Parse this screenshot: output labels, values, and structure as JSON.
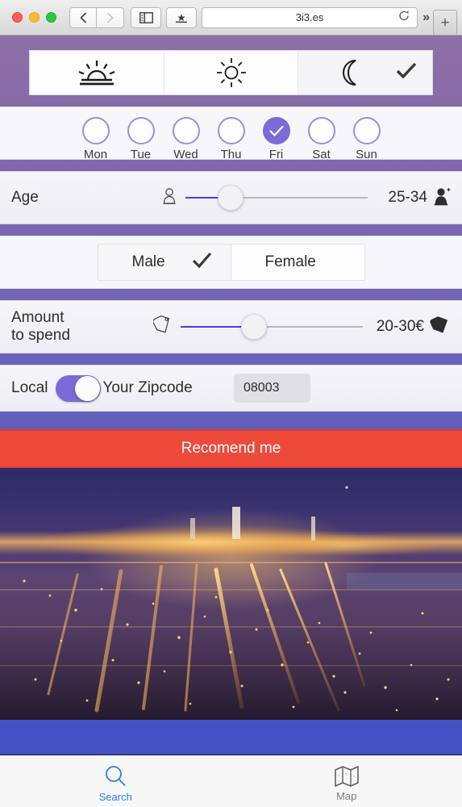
{
  "browser": {
    "url": "3i3.es",
    "back_label": "‹",
    "forward_label": "›",
    "sidebar_icon": "sidebar-icon",
    "bookmark_icon": "bookmarks-icon",
    "reload_icon": "reload-icon",
    "more_label": "»",
    "newtab_label": "+",
    "traffic": {
      "close": "close",
      "minimize": "minimize",
      "zoom": "zoom"
    }
  },
  "timeofday": {
    "items": [
      {
        "icon": "sunrise-icon",
        "name": "sunrise",
        "selected": false
      },
      {
        "icon": "sun-icon",
        "name": "midday",
        "selected": false
      },
      {
        "icon": "moon-icon",
        "name": "night",
        "selected": true
      }
    ],
    "check_glyph": "✔"
  },
  "days": {
    "items": [
      {
        "label": "Mon",
        "selected": false
      },
      {
        "label": "Tue",
        "selected": false
      },
      {
        "label": "Wed",
        "selected": false
      },
      {
        "label": "Thu",
        "selected": false
      },
      {
        "label": "Fri",
        "selected": true
      },
      {
        "label": "Sat",
        "selected": false
      },
      {
        "label": "Sun",
        "selected": false
      }
    ],
    "check_glyph": "✓"
  },
  "age": {
    "label": "Age",
    "value": "25-34",
    "fill_percent": 25,
    "left_icon": "person-small-icon",
    "right_icon": "person-large-icon"
  },
  "gender": {
    "options": [
      {
        "label": "Male",
        "selected": true
      },
      {
        "label": "Female",
        "selected": false
      }
    ],
    "check_glyph": "✔"
  },
  "amount": {
    "label_line1": "Amount",
    "label_line2": "to spend",
    "value": "20-30€",
    "fill_percent": 40,
    "left_icon": "pricetag-outline-icon",
    "right_icon": "pricetag-filled-icon"
  },
  "local": {
    "label": "Local",
    "toggle_on": true,
    "zipcode_label": "Your Zipcode",
    "zipcode_value": "08003"
  },
  "cta": {
    "label": "Recomend me"
  },
  "photo": {
    "alt": "night city skyline"
  },
  "tabbar": {
    "tabs": [
      {
        "label": "Search",
        "icon": "search-icon",
        "active": true
      },
      {
        "label": "Map",
        "icon": "map-icon",
        "active": false
      }
    ]
  },
  "colors": {
    "accent_purple": "#7c6ad8",
    "slider_fill": "#5b31f0",
    "cta_red": "#ed4a3c",
    "tab_active": "#2f7de1"
  }
}
